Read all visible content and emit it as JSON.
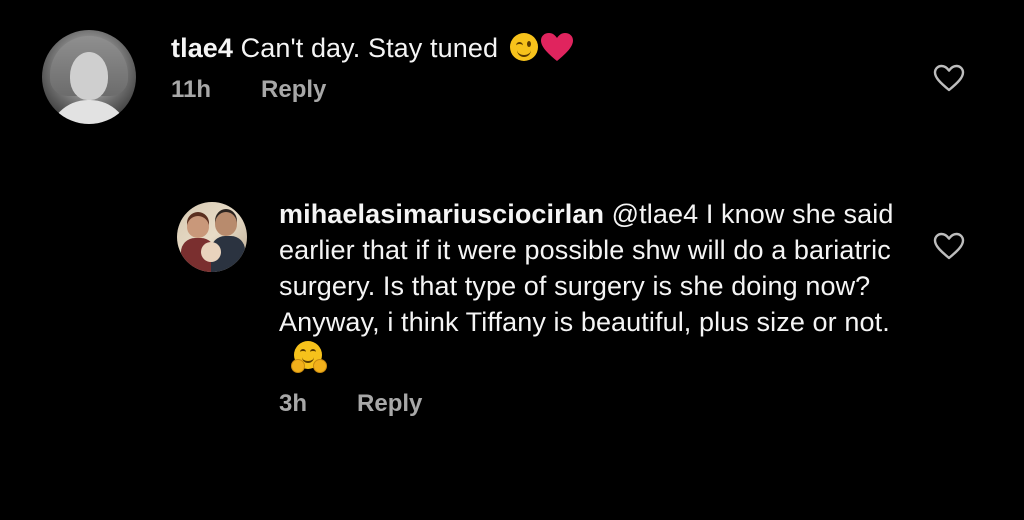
{
  "comments": [
    {
      "username": "tlae4",
      "text": "Can't day.  Stay tuned",
      "emojis": [
        "winking-face-emoji",
        "red-heart-emoji"
      ],
      "time": "11h",
      "reply_label": "Reply",
      "like_icon": "heart-outline-icon"
    },
    {
      "username": "mihaelasimariusciocirlan",
      "mention": "@tlae4",
      "text": "I know she said earlier that if it were possible shw will do a bariatric surgery. Is that type of surgery is she doing now? Anyway, i think Tiffany is beautiful, plus size or not.",
      "emojis": [
        "hugging-face-emoji"
      ],
      "time": "3h",
      "reply_label": "Reply",
      "like_icon": "heart-outline-icon"
    }
  ],
  "colors": {
    "background": "#000000",
    "text": "#f5f5f5",
    "meta": "#a8a8a8",
    "heart_emoji": "#e0245e",
    "emoji_yellow": "#f7c21b"
  }
}
